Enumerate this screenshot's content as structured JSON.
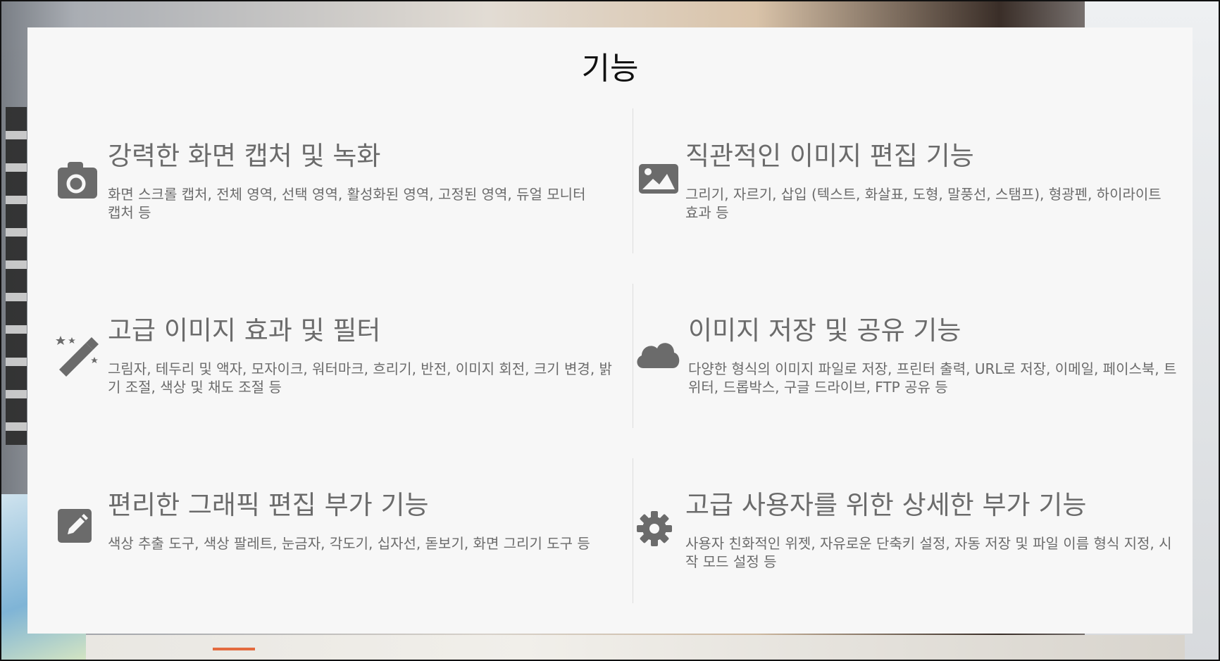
{
  "section": {
    "title": "기능"
  },
  "features": [
    {
      "title": "강력한 화면 캡처 및 녹화",
      "description": "화면 스크롤 캡처, 전체 영역, 선택 영역, 활성화된 영역, 고정된 영역, 듀얼 모니터 캡처 등",
      "icon": "camera-icon"
    },
    {
      "title": "직관적인 이미지 편집 기능",
      "description": "그리기, 자르기, 삽입 (텍스트, 화살표, 도형, 말풍선, 스탬프), 형광펜, 하이라이트 효과 등",
      "icon": "image-icon"
    },
    {
      "title": "고급 이미지 효과 및 필터",
      "description": "그림자, 테두리 및 액자, 모자이크, 워터마크, 흐리기, 반전, 이미지 회전, 크기 변경, 밝기 조절, 색상 및 채도 조절 등",
      "icon": "magic-wand-icon"
    },
    {
      "title": "이미지 저장 및 공유 기능",
      "description": "다양한 형식의 이미지 파일로 저장, 프린터 출력, URL로 저장, 이메일, 페이스북, 트위터, 드롭박스, 구글 드라이브, FTP 공유 등",
      "icon": "cloud-icon"
    },
    {
      "title": "편리한 그래픽 편집 부가 기능",
      "description": "색상 추출 도구, 색상 팔레트, 눈금자, 각도기, 십자선, 돋보기, 화면 그리기 도구 등",
      "icon": "pencil-icon"
    },
    {
      "title": "고급 사용자를 위한 상세한 부가 기능",
      "description": "사용자 친화적인 위젯, 자유로운 단축키 설정, 자동 저장 및 파일 이름 형식 지정, 시작 모드 설정 등",
      "icon": "gear-icon"
    }
  ],
  "colors": {
    "icon": "#6b6b6b",
    "text": "#6b6b6b",
    "title": "#111111",
    "panel": "#f7f7f7",
    "divider": "#dcdcdc"
  }
}
